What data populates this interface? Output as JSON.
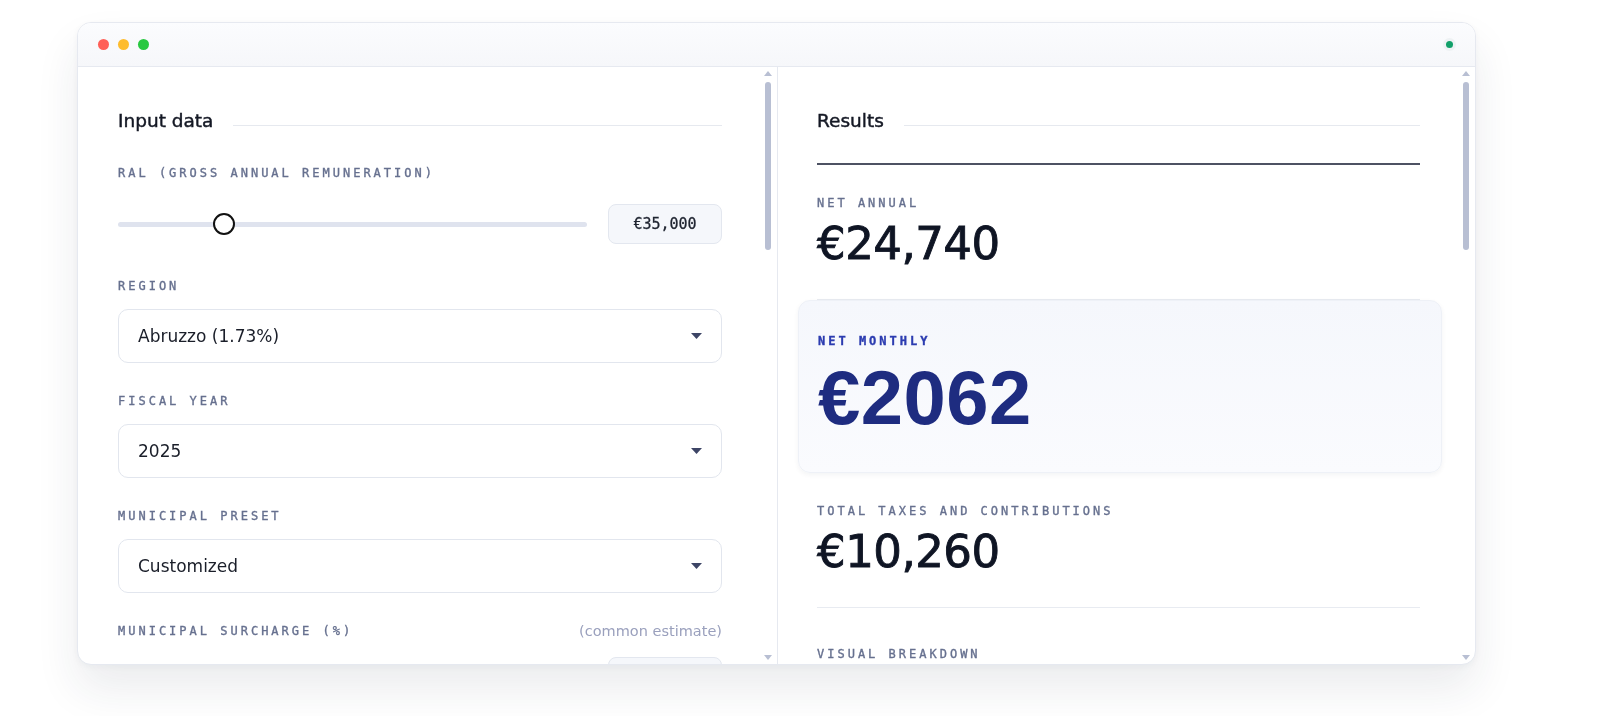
{
  "input_panel": {
    "title": "Input data",
    "fields": [
      {
        "kind": "slider",
        "label": "RAL (GROSS ANNUAL REMUNERATION)",
        "level": 0.225,
        "value": "€35,000"
      },
      {
        "kind": "select",
        "label": "REGION",
        "value": "Abruzzo (1.73%)"
      },
      {
        "kind": "select",
        "label": "FISCAL YEAR",
        "value": "2025"
      },
      {
        "kind": "select",
        "label": "MUNICIPAL PRESET",
        "value": "Customized"
      },
      {
        "kind": "input",
        "label": "MUNICIPAL SURCHARGE (%)",
        "note": "(common estimate)"
      }
    ]
  },
  "results_panel": {
    "title": "Results",
    "items": [
      {
        "kind": "plain",
        "label": "NET ANNUAL",
        "value": "€24,740"
      },
      {
        "kind": "highlight",
        "label": "NET MONTHLY",
        "value": "€2062"
      },
      {
        "kind": "plain",
        "label": "TOTAL TAXES AND CONTRIBUTIONS",
        "value": "€10,260"
      },
      {
        "kind": "section",
        "label": "VISUAL BREAKDOWN"
      }
    ]
  }
}
